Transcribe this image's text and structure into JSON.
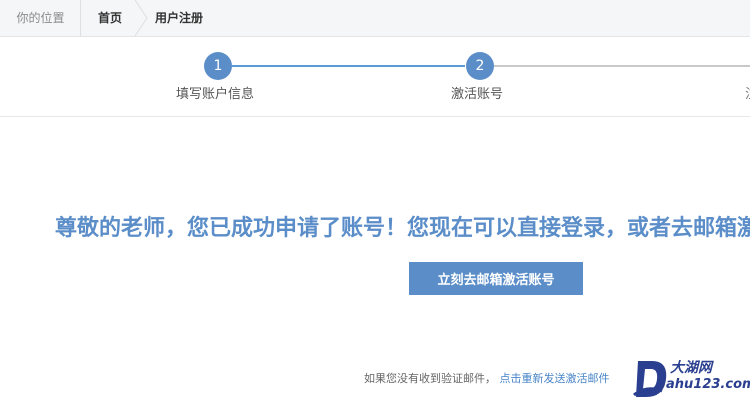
{
  "breadcrumb": {
    "label": "你的位置",
    "home": "首页",
    "current": "用户注册"
  },
  "steps": [
    {
      "number": "1",
      "label": "填写账户信息"
    },
    {
      "number": "2",
      "label": "激活账号"
    },
    {
      "number": "",
      "label": "注"
    }
  ],
  "main": {
    "message": "尊敬的老师，您已成功申请了账号！您现在可以直接登录，或者去邮箱激活账号",
    "button_label": "立刻去邮箱激活账号"
  },
  "hint": {
    "text": "如果您没有收到验证邮件，",
    "link": "点击重新发送激活邮件"
  },
  "watermark": {
    "letter": "D",
    "cn": "大湖网",
    "en": "ahu123.com"
  },
  "colors": {
    "accent": "#5b8ec9",
    "link": "#4a86c8",
    "inactive_line": "#c9c9c9"
  }
}
